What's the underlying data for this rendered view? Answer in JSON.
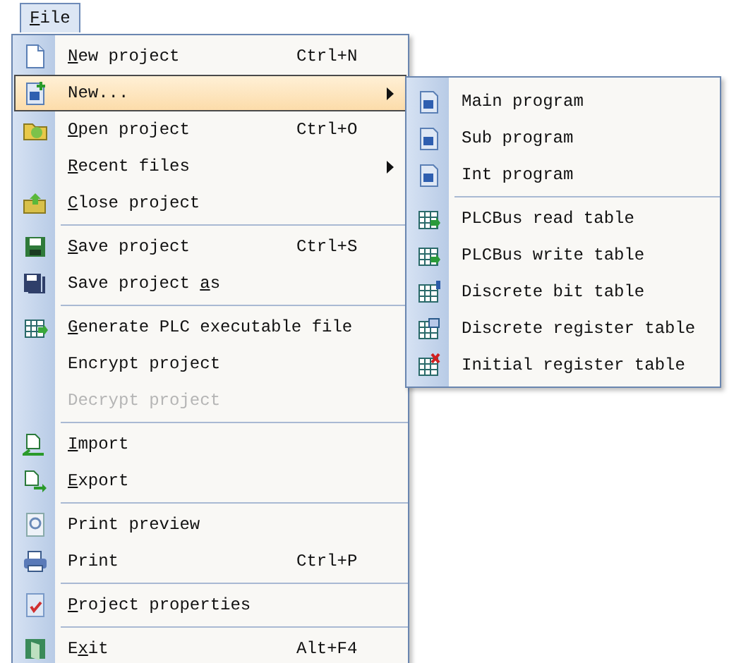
{
  "menubar": [
    {
      "label": {
        "key": "F",
        "after": "ile"
      },
      "selected": true
    }
  ],
  "file_menu": [
    {
      "kind": "item",
      "label": {
        "key": "N",
        "after": "ew project"
      },
      "shortcut": "Ctrl+N",
      "submenu": false,
      "selected": false,
      "disabled": false
    },
    {
      "kind": "item",
      "label": {
        "before": "New..."
      },
      "submenu": true,
      "selected": true,
      "disabled": false
    },
    {
      "kind": "item",
      "label": {
        "key": "O",
        "after": "pen project"
      },
      "shortcut": "Ctrl+O",
      "submenu": false,
      "selected": false,
      "disabled": false
    },
    {
      "kind": "item",
      "label": {
        "key": "R",
        "after": "ecent files"
      },
      "submenu": true,
      "selected": false,
      "disabled": false
    },
    {
      "kind": "item",
      "label": {
        "key": "C",
        "after": "lose project"
      },
      "submenu": false,
      "selected": false,
      "disabled": false
    },
    {
      "kind": "separator"
    },
    {
      "kind": "item",
      "label": {
        "key": "S",
        "after": "ave project"
      },
      "shortcut": "Ctrl+S",
      "submenu": false,
      "selected": false,
      "disabled": false
    },
    {
      "kind": "item",
      "label": {
        "before": "Save project ",
        "key": "a",
        "after": "s"
      },
      "submenu": false,
      "selected": false,
      "disabled": false
    },
    {
      "kind": "separator"
    },
    {
      "kind": "item",
      "label": {
        "key": "G",
        "after": "enerate PLC executable file"
      },
      "submenu": false,
      "selected": false,
      "disabled": false
    },
    {
      "kind": "item",
      "label": {
        "before": "Encrypt project"
      },
      "submenu": false,
      "selected": false,
      "disabled": false
    },
    {
      "kind": "item",
      "label": {
        "before": "Decrypt project"
      },
      "submenu": false,
      "selected": false,
      "disabled": true
    },
    {
      "kind": "separator"
    },
    {
      "kind": "item",
      "label": {
        "key": "I",
        "after": "mport"
      },
      "submenu": false,
      "selected": false,
      "disabled": false
    },
    {
      "kind": "item",
      "label": {
        "key": "E",
        "after": "xport"
      },
      "submenu": false,
      "selected": false,
      "disabled": false
    },
    {
      "kind": "separator"
    },
    {
      "kind": "item",
      "label": {
        "before": "Print preview"
      },
      "submenu": false,
      "selected": false,
      "disabled": false
    },
    {
      "kind": "item",
      "label": {
        "before": "Print"
      },
      "shortcut": "Ctrl+P",
      "submenu": false,
      "selected": false,
      "disabled": false
    },
    {
      "kind": "separator"
    },
    {
      "kind": "item",
      "label": {
        "key": "P",
        "after": "roject properties"
      },
      "submenu": false,
      "selected": false,
      "disabled": false
    },
    {
      "kind": "separator"
    },
    {
      "kind": "item",
      "label": {
        "before": "E",
        "key": "x",
        "after": "it"
      },
      "shortcut": "Alt+F4",
      "submenu": false,
      "selected": false,
      "disabled": false
    }
  ],
  "new_submenu": [
    {
      "kind": "item",
      "label": "Main program"
    },
    {
      "kind": "item",
      "label": "Sub program"
    },
    {
      "kind": "item",
      "label": "Int program"
    },
    {
      "kind": "separator"
    },
    {
      "kind": "item",
      "label": "PLCBus read table"
    },
    {
      "kind": "item",
      "label": "PLCBus write table"
    },
    {
      "kind": "item",
      "label": "Discrete bit table"
    },
    {
      "kind": "item",
      "label": "Discrete register table"
    },
    {
      "kind": "item",
      "label": "Initial register table"
    }
  ]
}
